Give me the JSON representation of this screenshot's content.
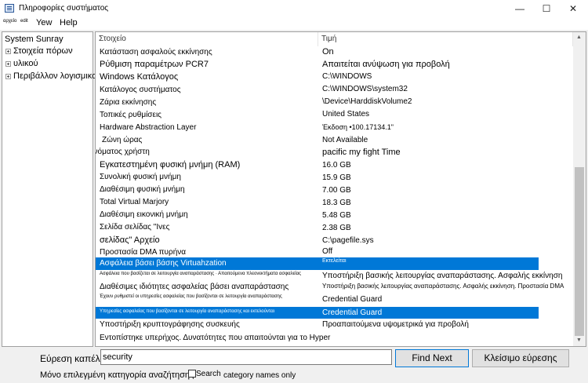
{
  "window": {
    "title": "Πληροφορίες συστήματος",
    "minimize_glyph": "—",
    "maximize_glyph": "☐",
    "close_glyph": "✕"
  },
  "menu": {
    "file": "αρχείο",
    "edit": "edit",
    "view": "Yew",
    "help": "Help"
  },
  "tree": {
    "root": "System Sunray",
    "items": [
      "Στοιχεία πόρων",
      "υλικού",
      "Περιβάλλον λογισμικού"
    ]
  },
  "list": {
    "col_item": "Στοιχείο",
    "col_value": "Τιμή",
    "rows": [
      {
        "item": "Κατάσταση ασφαλούς εκκίνησης",
        "value": "On"
      },
      {
        "item": "Ρύθμιση παραμέτρων PCR7",
        "value": "Απαιτείται ανύψωση για προβολή"
      },
      {
        "item": "Windows Κατάλογος",
        "value": "C:\\WINDOWS"
      },
      {
        "item": "Κατάλογος συστήματος",
        "value": "C:\\WINDOWS\\system32"
      },
      {
        "item": "Ζάρια εκκίνησης",
        "value": "\\Device\\HarddiskVolume2"
      },
      {
        "item": "Τοπικές ρυθμίσεις",
        "value": "United States"
      },
      {
        "item": "Hardware Abstraction Layer",
        "value": "Έκδοση •100.17134.1\""
      },
      {
        "item": "Ζώνη ώρας",
        "value": "Not Available"
      },
      {
        "item": "ονόματος χρήστη",
        "value": "pacific my fight Time"
      },
      {
        "item": "Εγκατεστημένη φυσική μνήμη (RAM)",
        "value": "16.0 GB"
      },
      {
        "item": "Συνολική φυσική μνήμη",
        "value": "15.9 GB"
      },
      {
        "item": "Διαθέσιμη φυσική μνήμη",
        "value": "7.00 GB"
      },
      {
        "item": "Total Virtual Marjory",
        "value": "18.3 GB"
      },
      {
        "item": "Διαθέσιμη εικονική μνήμη",
        "value": "5.48 GB"
      },
      {
        "item": "Σελίδα σελίδας \"Ivες",
        "value": "2.38 GB"
      },
      {
        "item": "σελίδας\" Αρχείο",
        "value": "C:\\pagefile.sys"
      },
      {
        "item": "Προστασία DMA πυρήνα",
        "value": "Off"
      },
      {
        "item": "Ασφάλεια βάσει βάσης Virtuahzation",
        "value": "Εκτελείται"
      },
      {
        "item": "Ασφάλεια που βασίζεται σε λειτουργία αναπαράστασης · Απαιτούμενα πλεονεκτήματα ασφαλείας",
        "value": "Υποστήριξη βασικής λειτουργίας αναπαράστασης. Ασφαλής εκκίνηση"
      },
      {
        "item": "Διαθέσιμες ιδιότητες ασφαλείας βάσει αναπαράστασης",
        "value": "Υποστήριξη βασικής λειτουργίας αναπαράστασης. Ασφαλής εκκίνηση. Προστασία DMA"
      },
      {
        "item": "Έχουν ρυθμιστεί οι υπηρεσίες ασφαλείας που βασίζονται σε λειτουργία αναπαράστασης",
        "value": "Credential Guard"
      },
      {
        "item": "Υπηρεσίες ασφαλείας που βασίζονται σε λειτουργία αναπαράστασης και εκτελούνται",
        "value": "Credential Guard"
      },
      {
        "item": "Υποστήριξη κρυπτογράφησης συσκευής",
        "value": "Προαπαιτούμενα υψομετρικά για προβολή"
      },
      {
        "item": "Εντοπίστηκε υπερήχος. Δυνατότητες που απαιτούνται για το Hyper",
        "value": ""
      }
    ]
  },
  "find": {
    "label": "Εύρεση καπέλου",
    "value": "security",
    "find_next": "Find Next",
    "close_find": "Κλείσιμο εύρεσης",
    "only_selected": "Μόνο επιλεγμένη κατηγορία αναζήτησης",
    "search": "Search",
    "category_names": "category names only"
  }
}
